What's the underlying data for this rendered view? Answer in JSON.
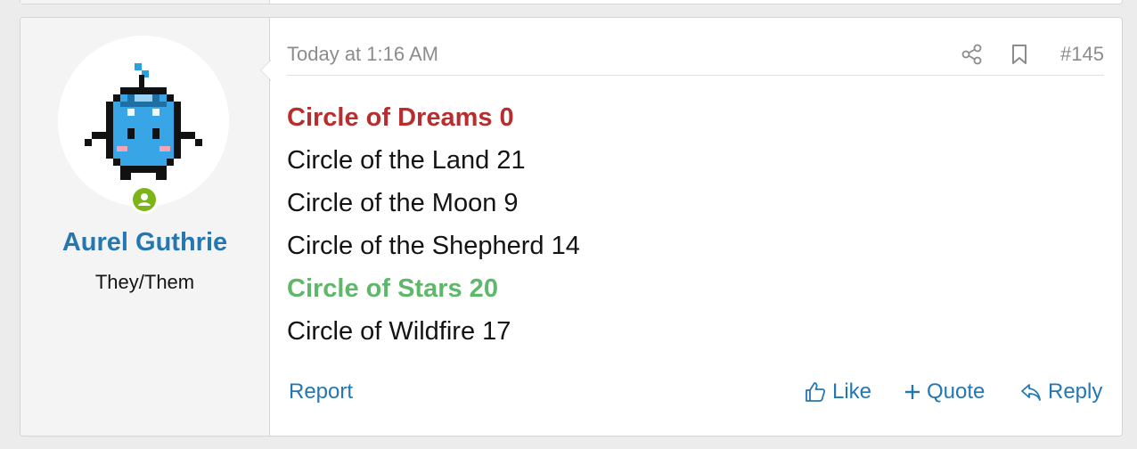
{
  "post": {
    "date": "Today at 1:16 AM",
    "number": "#145",
    "lines": [
      {
        "text": "Circle of Dreams 0",
        "color": "#b82d2d",
        "bold": true
      },
      {
        "text": "Circle of the Land 21",
        "color": "#141414",
        "bold": false
      },
      {
        "text": "Circle of the Moon 9",
        "color": "#141414",
        "bold": false
      },
      {
        "text": "Circle of the Shepherd 14",
        "color": "#141414",
        "bold": false
      },
      {
        "text": "Circle of Stars 20",
        "color": "#5fb86a",
        "bold": true
      },
      {
        "text": "Circle of Wildfire 17",
        "color": "#141414",
        "bold": false
      }
    ],
    "icons": {
      "share": "share-icon",
      "bookmark": "bookmark-icon"
    }
  },
  "user": {
    "name": "Aurel Guthrie",
    "title": "They/Them",
    "status": "online",
    "status_color": "#7bb518",
    "name_color": "#2577b1"
  },
  "footer": {
    "report_label": "Report",
    "like_label": "Like",
    "quote_label": "Quote",
    "reply_label": "Reply",
    "link_color": "#2577b1"
  }
}
